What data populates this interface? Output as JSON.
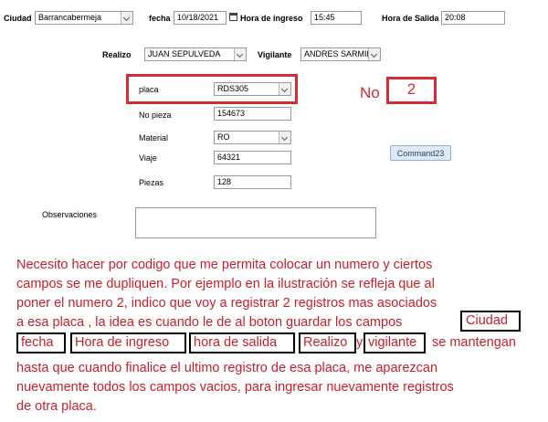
{
  "header": {
    "ciudad_label": "Ciudad",
    "ciudad_value": "Barrancabermeja",
    "fecha_label": "fecha",
    "fecha_value": "10/18/2021",
    "hora_ingreso_label": "Hora de ingreso",
    "hora_ingreso_value": "15:45",
    "hora_salida_label": "Hora de Salida",
    "hora_salida_value": "20:08"
  },
  "row2": {
    "realizo_label": "Realizo",
    "realizo_value": "JUAN SEPULVEDA",
    "vigilante_label": "Vigilante",
    "vigilante_value": "ANDRES SARMIENTO"
  },
  "form": {
    "placa_label": "placa",
    "placa_value": "RDS305",
    "no_pieza_label": "No pieza",
    "no_pieza_value": "154673",
    "material_label": "Material",
    "material_value": "RO",
    "viaje_label": "Viaje",
    "viaje_value": "64321",
    "piezas_label": "Piezas",
    "piezas_value": "128",
    "observaciones_label": "Observaciones",
    "observaciones_value": ""
  },
  "no": {
    "label": "No",
    "value": "2"
  },
  "command_label": "Command23",
  "note_lines": [
    "Necesito hacer por codigo que me permita colocar un numero y ciertos",
    "campos se me dupliquen. Por ejemplo en la ilustración se refleja que al",
    "poner  el numero 2, indico que voy a registrar 2 registros mas asociados",
    "a esa  placa , la idea es cuando le de al boton guardar los campos",
    "se mantengan",
    "hasta que cuando finalice el ultimo registro de esa placa, me aparezcan",
    "nuevamente todos los campos vacios, para ingresar nuevamente registros",
    "de otra placa."
  ],
  "highlight_words": [
    "Ciudad",
    "fecha",
    "Hora de ingreso",
    "hora de salida",
    "Realizo",
    "y",
    "vigilante"
  ],
  "colors": {
    "annotation_red": "#d42b35",
    "note_text": "#c8202b",
    "button_blue": "#dfeaf6"
  }
}
